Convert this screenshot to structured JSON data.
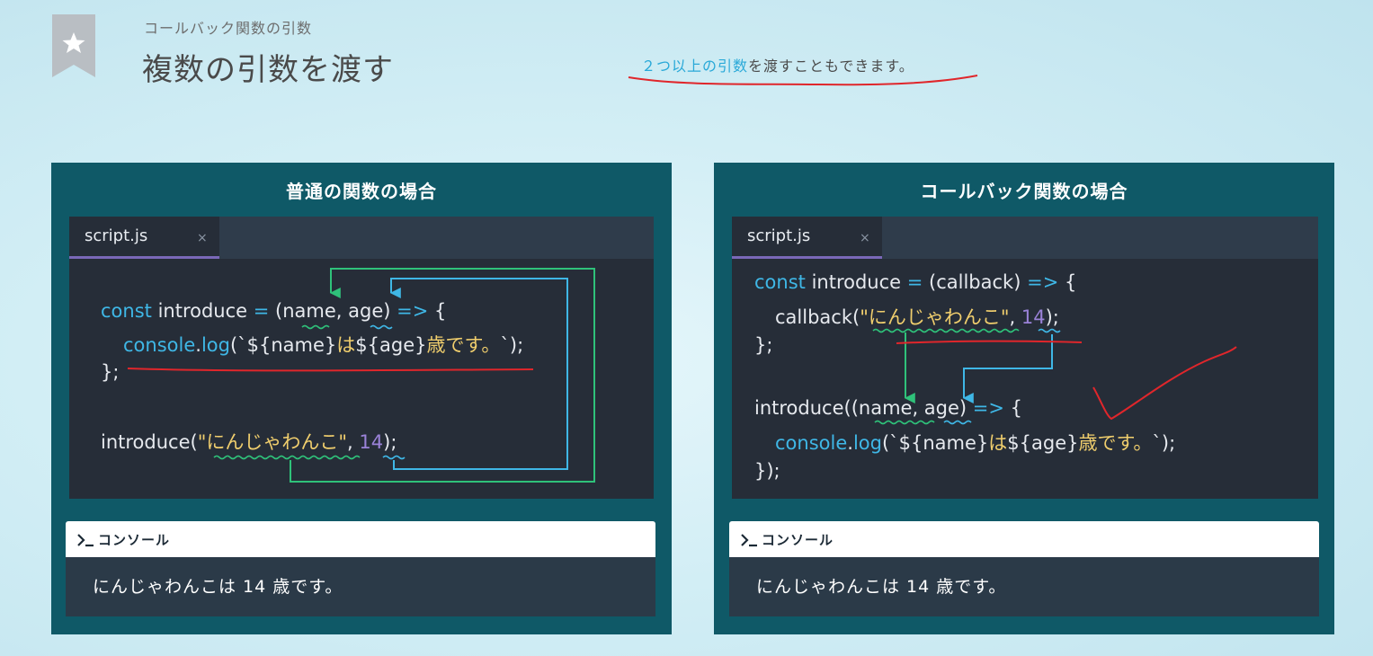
{
  "header": {
    "breadcrumb": "コールバック関数の引数",
    "title": "複数の引数を渡す"
  },
  "note": {
    "highlight": "２つ以上の引数",
    "rest": "を渡すこともできます。"
  },
  "icons": {
    "bookmark": "star-icon",
    "console": "terminal-prompt-icon",
    "tab_close": "close-icon"
  },
  "colors": {
    "panel": "#0f5967",
    "editor": "#262d38",
    "keyword": "#3fb7e6",
    "string": "#f0ce6d",
    "number": "#9a82d8",
    "arrow_green": "#2fc27a",
    "arrow_blue": "#3fb7e6",
    "annotation_red": "#e0262b"
  },
  "panels": [
    {
      "title": "普通の関数の場合",
      "tab": {
        "label": "script.js",
        "close": "×"
      },
      "code": {
        "l1": {
          "kw1": "const",
          "t1": " introduce ",
          "op": "=",
          "t2": " (name, age) ",
          "arrow": "=>",
          "t3": " {"
        },
        "l2": {
          "kw1": "console",
          "t1": ".",
          "kw2": "log",
          "t2": "(`${name}",
          "s1": "は",
          "t3": "${age}",
          "s2": "歳です。",
          "t4": "`);"
        },
        "l3": "};",
        "l5": {
          "t1": "introduce(",
          "s1": "\"にんじゃわんこ\"",
          "t2": ", ",
          "n1": "14",
          "t3": ");"
        }
      },
      "console": {
        "label": "コンソール",
        "output": "にんじゃわんこは 14 歳です。"
      }
    },
    {
      "title": "コールバック関数の場合",
      "tab": {
        "label": "script.js",
        "close": "×"
      },
      "code": {
        "l1": {
          "kw1": "const",
          "t1": " introduce ",
          "op": "=",
          "t2": " (callback) ",
          "arrow": "=>",
          "t3": " {"
        },
        "l2": {
          "t1": "callback(",
          "s1": "\"にんじゃわんこ\"",
          "t2": ", ",
          "n1": "14",
          "t3": ");"
        },
        "l3": "};",
        "l5": {
          "t1": "introduce((name, age) ",
          "arrow": "=>",
          "t2": " {"
        },
        "l6": {
          "kw1": "console",
          "t1": ".",
          "kw2": "log",
          "t2": "(`${name}",
          "s1": "は",
          "t3": "${age}",
          "s2": "歳です。",
          "t4": "`);"
        },
        "l7": "});"
      },
      "console": {
        "label": "コンソール",
        "output": "にんじゃわんこは 14 歳です。"
      }
    }
  ]
}
